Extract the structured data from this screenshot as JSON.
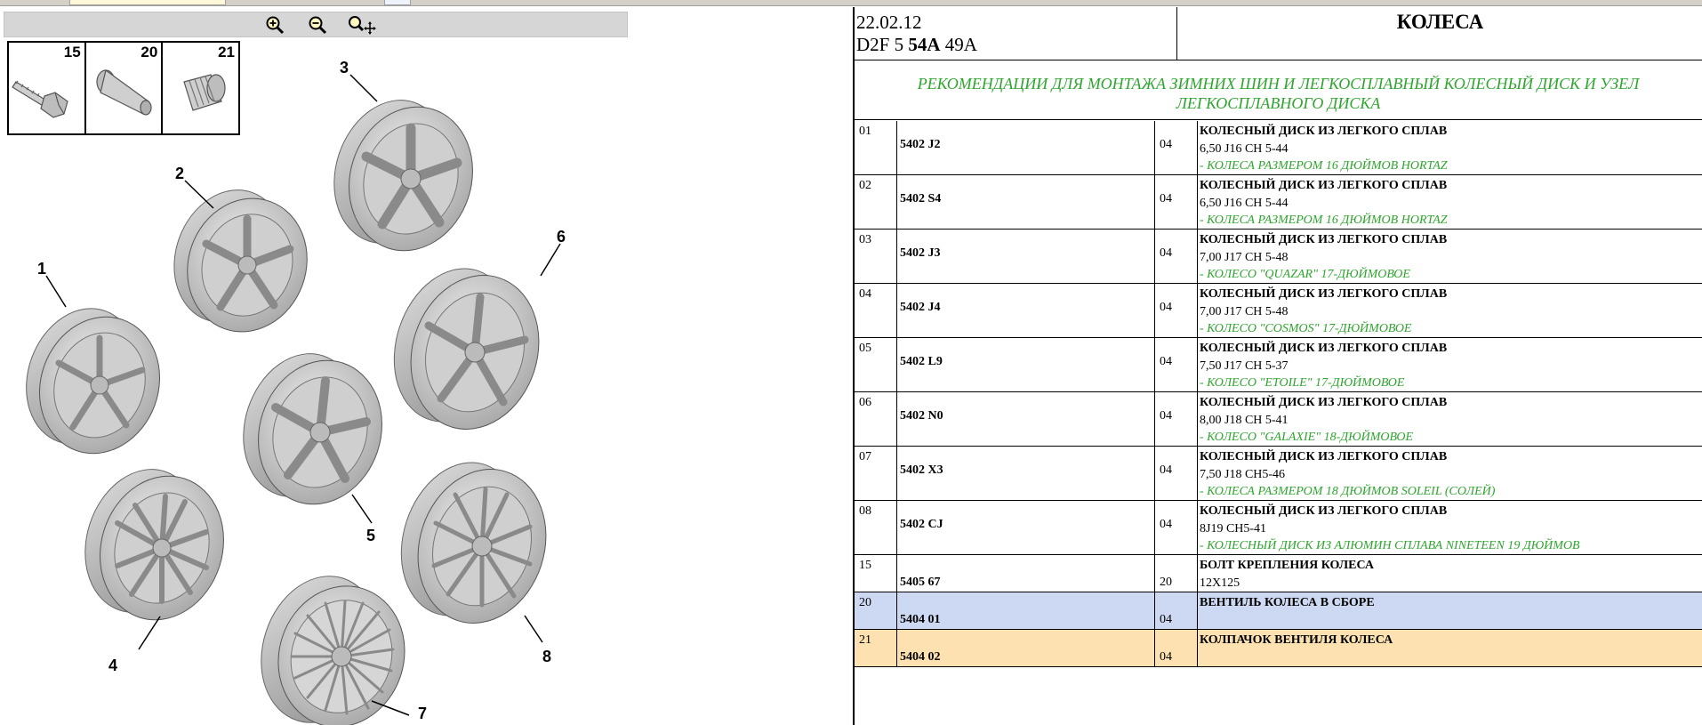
{
  "header": {
    "date": "22.02.12",
    "code_prefix": "D2F 5",
    "code_bold": "54A",
    "code_suffix": "49A",
    "title": "КОЛЕСА"
  },
  "subtitle": "РЕКОМЕНДАЦИИ ДЛЯ МОНТАЖА ЗИМНИХ ШИН И ЛЕГКОСПЛАВНЫЙ КОЛЕСНЫЙ ДИСК И УЗЕЛ ЛЕГКОСПЛАВНОГО ДИСКА",
  "toolbar": {
    "icons": [
      "zoom-in-icon",
      "zoom-out-icon",
      "zoom-pan-icon"
    ]
  },
  "small_parts": [
    "15",
    "20",
    "21"
  ],
  "callouts": [
    "1",
    "2",
    "3",
    "4",
    "5",
    "6",
    "7",
    "8"
  ],
  "colors": {
    "note_green": "#2ea62e",
    "row_blue": "#cdd9f3",
    "row_orange": "#fde1b1"
  },
  "parts": [
    {
      "pos": "01",
      "ref": "5402 J2",
      "qty": "04",
      "name": "КОЛЕСНЫЙ ДИСК ИЗ ЛЕГКОГО СПЛАВ",
      "spec": "6,50 J16 CH 5-44",
      "note": "- КОЛЕСА РАЗМЕРОМ 16 ДЮЙМОВ HORTAZ"
    },
    {
      "pos": "02",
      "ref": "5402 S4",
      "qty": "04",
      "name": "КОЛЕСНЫЙ ДИСК ИЗ ЛЕГКОГО СПЛАВ",
      "spec": "6,50 J16 CH 5-44",
      "note": "- КОЛЕСА РАЗМЕРОМ 16 ДЮЙМОВ HORTAZ"
    },
    {
      "pos": "03",
      "ref": "5402 J3",
      "qty": "04",
      "name": "КОЛЕСНЫЙ ДИСК ИЗ ЛЕГКОГО СПЛАВ",
      "spec": "7,00 J17 CH 5-48",
      "note": "- КОЛЕСО \"QUAZAR\" 17-ДЮЙМОВОЕ"
    },
    {
      "pos": "04",
      "ref": "5402 J4",
      "qty": "04",
      "name": "КОЛЕСНЫЙ ДИСК ИЗ ЛЕГКОГО СПЛАВ",
      "spec": "7,00 J17 CH 5-48",
      "note": "- КОЛЕСО \"COSMOS\" 17-ДЮЙМОВОЕ"
    },
    {
      "pos": "05",
      "ref": "5402 L9",
      "qty": "04",
      "name": "КОЛЕСНЫЙ ДИСК ИЗ ЛЕГКОГО СПЛАВ",
      "spec": "7,50 J17 CH 5-37",
      "note": "- КОЛЕСО \"ETOILE\" 17-ДЮЙМОВОЕ"
    },
    {
      "pos": "06",
      "ref": "5402 N0",
      "qty": "04",
      "name": "КОЛЕСНЫЙ ДИСК ИЗ ЛЕГКОГО СПЛАВ",
      "spec": "8,00 J18 CH 5-41",
      "note": "- КОЛЕСО \"GALAXIE\" 18-ДЮЙМОВОЕ"
    },
    {
      "pos": "07",
      "ref": "5402 X3",
      "qty": "04",
      "name": "КОЛЕСНЫЙ ДИСК ИЗ ЛЕГКОГО СПЛАВ",
      "spec": "7,50 J18 CH5-46",
      "note": "- КОЛЕСА РАЗМЕРОМ 18 ДЮЙМОВ SOLEIL (СОЛЕЙ)"
    },
    {
      "pos": "08",
      "ref": "5402 CJ",
      "qty": "04",
      "name": "КОЛЕСНЫЙ ДИСК ИЗ ЛЕГКОГО СПЛАВ",
      "spec": "8J19 CH5-41",
      "note": "- КОЛЕСНЫЙ ДИСК ИЗ АЛЮМИН СПЛАВА NINETEEN 19 ДЮЙМОВ"
    },
    {
      "pos": "15",
      "ref": "5405 67",
      "qty": "20",
      "name": "БОЛТ КРЕПЛЕНИЯ КОЛЕСА",
      "spec": "12X125",
      "note": ""
    },
    {
      "pos": "20",
      "ref": "5404 01",
      "qty": "04",
      "name": "ВЕНТИЛЬ КОЛЕСА В СБОРЕ",
      "spec": "",
      "note": ""
    },
    {
      "pos": "21",
      "ref": "5404 02",
      "qty": "04",
      "name": "КОЛПАЧОК ВЕНТИЛЯ КОЛЕСА",
      "spec": "",
      "note": ""
    }
  ]
}
